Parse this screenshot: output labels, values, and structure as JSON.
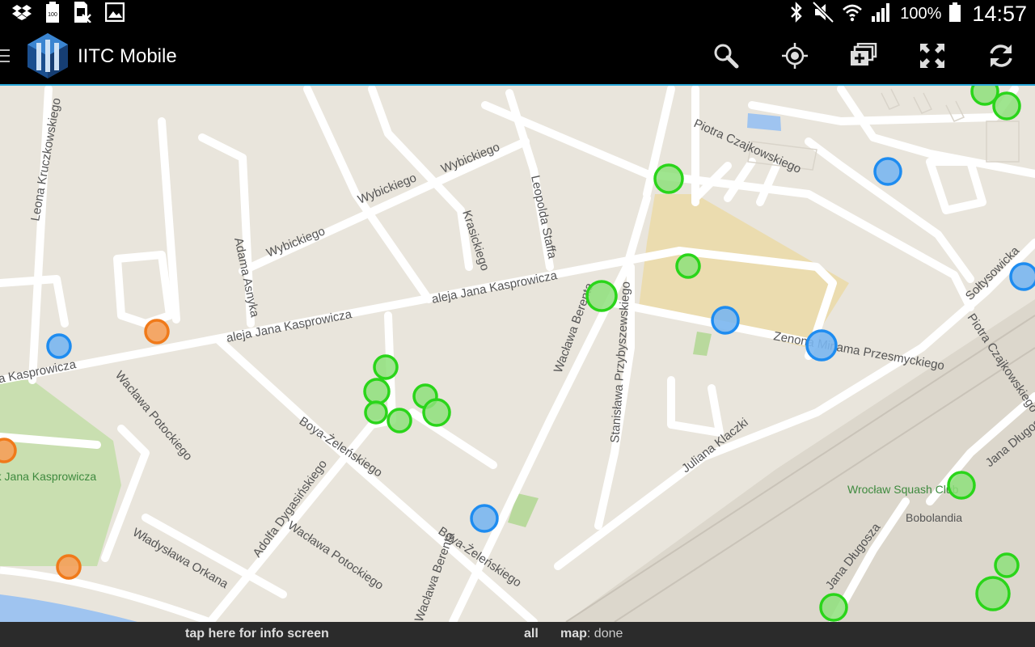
{
  "status_bar": {
    "battery_percent": "100%",
    "time": "14:57",
    "icons": [
      "dropbox-icon",
      "battery-100-icon",
      "sim-off-icon",
      "image-icon",
      "bluetooth-icon",
      "mute-icon",
      "wifi-icon",
      "signal-icon",
      "battery-icon"
    ]
  },
  "action_bar": {
    "title": "IITC Mobile",
    "actions": [
      "search-icon",
      "locate-icon",
      "layers-icon",
      "fullscreen-icon",
      "refresh-icon"
    ],
    "accent_color": "#2aa7d8"
  },
  "map": {
    "streets": [
      "Wybickiego",
      "Wybickiego",
      "Wybickiego",
      "Krasickiego",
      "Leopolda Staffa",
      "Leona Kruczkowskiego",
      "Adama Asnyka",
      "aleja Jana Kasprowicza",
      "aleja Jana Kasprowicza",
      "aleja Jana Kasprowicza",
      "Wacława Berenta",
      "Stanisława Przybyszewskiego",
      "Zenona Miriama Przesmyckiego",
      "Piotra Czajkowskiego",
      "Piotra Czajkowskiego",
      "Juliana Klaczki",
      "Wacława Potockiego",
      "Boya-Żeleńskiego",
      "Boya-Żeleńskiego",
      "Adolfa Dygasińskiego",
      "Wacława Potockiego",
      "Władysława Orkana",
      "Wacława Berenta",
      "Jana Długosza",
      "Jana Długosza",
      "Sołtysowicka"
    ],
    "pois": [
      "Park Jana Kasprowicza",
      "Wrocław Squash Club",
      "Bobolandia"
    ],
    "portal_colors": {
      "enlightened": "#3bd62d",
      "resistance": "#1e90ff",
      "neutral": "#f0862a"
    }
  },
  "footer": {
    "info_link": "tap here for info screen",
    "filter": "all",
    "map_label": "map",
    "map_status": ": done"
  }
}
